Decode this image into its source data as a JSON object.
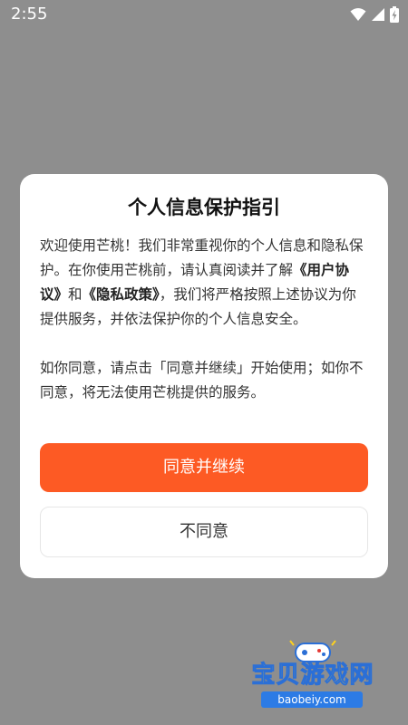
{
  "status_bar": {
    "time": "2:55"
  },
  "dialog": {
    "title": "个人信息保护指引",
    "paragraph1": {
      "part1": "欢迎使用芒桃！我们非常重视你的个人信息和隐私保护。在你使用芒桃前，请认真阅读并了解",
      "user_agreement_link": "《用户协议》",
      "part2": "和",
      "privacy_policy_link": "《隐私政策》",
      "part3": "，我们将严格按照上述协议为你提供服务，并依法保护你的个人信息安全。"
    },
    "paragraph2": "如你同意，请点击「同意并继续」开始使用；如你不同意，将无法使用芒桃提供的服务。",
    "agree_button": "同意并继续",
    "decline_button": "不同意"
  },
  "watermark": {
    "text": "宝贝游戏网",
    "url": "baobeiy.com"
  },
  "colors": {
    "overlay": "#8e8e8e",
    "accent": "#fd5a24",
    "dialog_bg": "#ffffff"
  }
}
